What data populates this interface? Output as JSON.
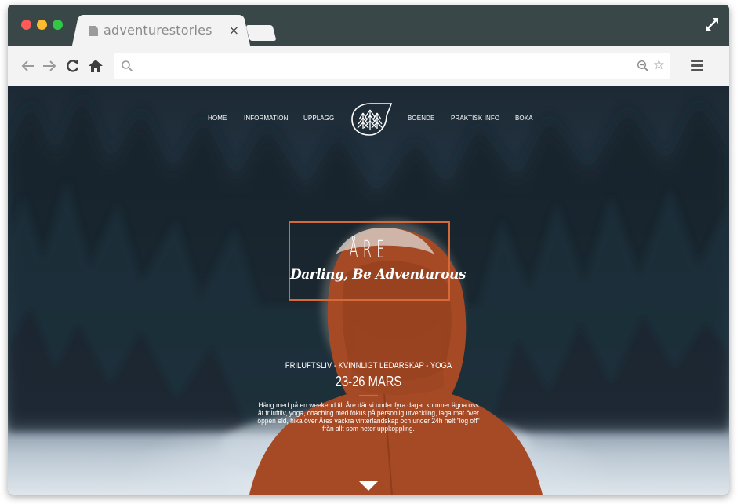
{
  "browser": {
    "tab_title": "adventurestories",
    "tab_close": "×",
    "address_value": "",
    "star_glyph": "☆"
  },
  "site": {
    "nav": [
      "HOME",
      "INFORMATION",
      "UPPLÄGG",
      "BOENDE",
      "PRAKTISK INFO",
      "BOKA"
    ],
    "hero_title": "ÅRE",
    "hero_subtitle": "Darling, Be Adventurous",
    "tagline": "FRILUFTSLIV - KVINNLIGT LEDARSKAP - YOGA",
    "dates": "23-26 MARS",
    "description": "Häng med på en weekend till Åre där vi under fyra dagar kommer ägna oss åt friluftliv, yoga, coaching med fokus på personlig utveckling, laga mat över öppen eld, hika över Åres vackra vinterlandskap och under 24h helt \"log off\" från allt som heter uppkoppling."
  },
  "colors": {
    "accent": "#d56a38",
    "titlebar": "#3a4749",
    "toolbar": "#f3f3f3"
  },
  "icons": [
    "back-arrow-icon",
    "forward-arrow-icon",
    "reload-icon",
    "home-icon",
    "search-icon",
    "zoom-out-icon",
    "star-icon",
    "menu-icon",
    "fullscreen-icon",
    "page-icon",
    "forest-logo-icon",
    "chevron-down-icon"
  ]
}
